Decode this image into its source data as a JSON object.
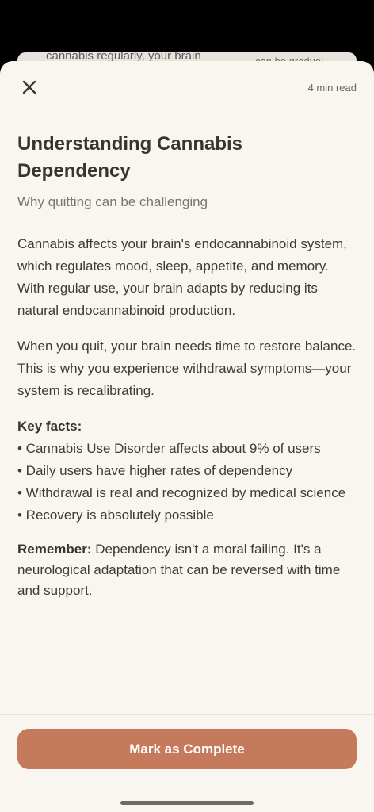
{
  "background_card": {
    "text_left": "cannabis regularly, your brain",
    "text_right": "can be gradual"
  },
  "header": {
    "read_time": "4 min read"
  },
  "article": {
    "title": "Understanding Cannabis Dependency",
    "subtitle": "Why quitting can be challenging",
    "paragraphs": [
      "Cannabis affects your brain's endocannabinoid system, which regulates mood, sleep, appetite, and memory. With regular use, your brain adapts by reducing its natural endocannabinoid production.",
      "When you quit, your brain needs time to restore balance. This is why you experience withdrawal symptoms—your system is recalibrating."
    ],
    "key_facts_title": "Key facts:",
    "key_facts": [
      "• Cannabis Use Disorder affects about 9% of users",
      "• Daily users have higher rates of dependency",
      "• Withdrawal is real and recognized by medical science",
      "• Recovery is absolutely possible"
    ],
    "remember_label": "Remember:",
    "remember_text": " Dependency isn't a moral failing. It's a neurological adaptation that can be reversed with time and support."
  },
  "footer": {
    "cta_label": "Mark as Complete"
  },
  "colors": {
    "sheet_background": "#f9f6f1",
    "accent": "#c67a5c",
    "text_primary": "#3a3430",
    "text_secondary": "#7b736c"
  },
  "icons": {
    "close": "close-icon"
  }
}
